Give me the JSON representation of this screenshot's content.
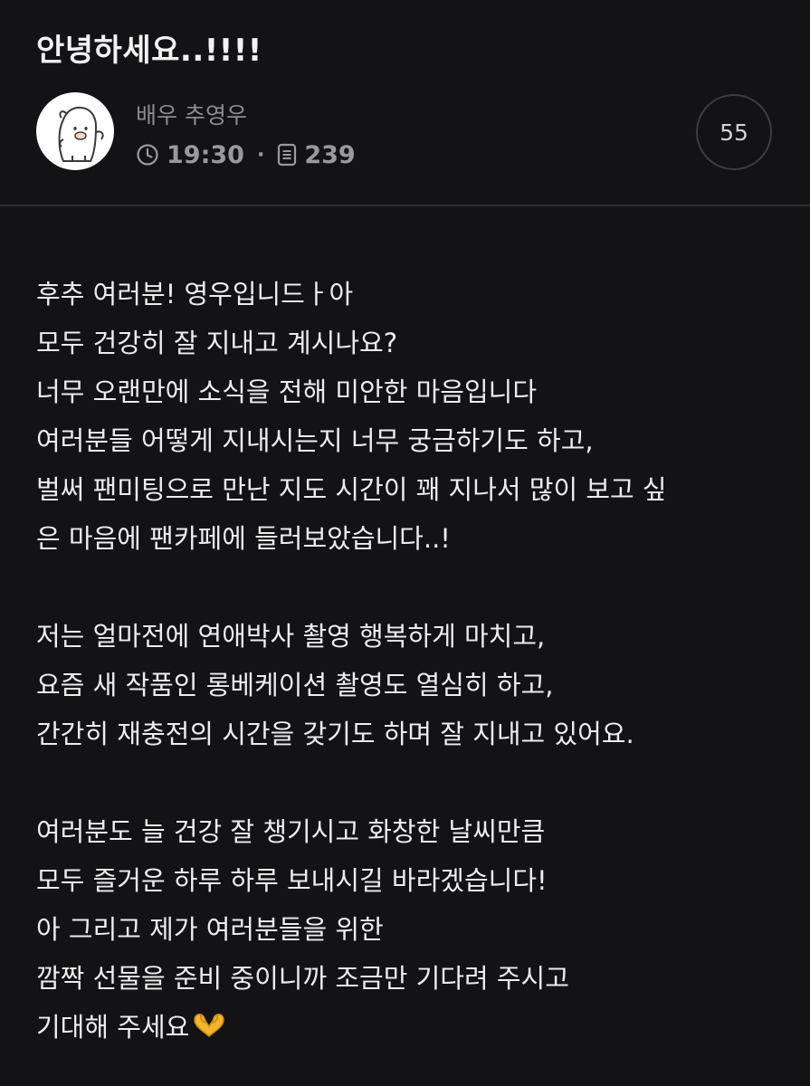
{
  "post": {
    "title": "안녕하세요..!!!!",
    "author": "배우 추영우",
    "time": "19:30",
    "separator": "·",
    "views": "239",
    "comment_count": "55"
  },
  "icons": {
    "avatar": "cartoon-character-avatar",
    "time": "clock-icon",
    "views": "document-icon",
    "emoji": "heart-hands-emoji"
  },
  "colors": {
    "background": "#131316",
    "text": "#ededed",
    "meta": "#9a9a9a",
    "divider": "#2e2e31",
    "emoji": "#f2b52b"
  },
  "body": {
    "paragraph1": [
      "후추 여러분! 영우입니드ㅏ아",
      "모두 건강히 잘 지내고 계시나요?",
      "너무 오랜만에 소식을 전해 미안한 마음입니다",
      "여러분들 어떻게 지내시는지 너무 궁금하기도 하고,",
      "벌써 팬미팅으로 만난 지도 시간이 꽤 지나서 많이 보고 싶",
      "은 마음에 팬카페에 들러보았습니다..!"
    ],
    "paragraph2": [
      "저는 얼마전에 연애박사 촬영 행복하게 마치고,",
      "요즘 새 작품인 롱베케이션 촬영도 열심히 하고,",
      "간간히 재충전의 시간을 갖기도 하며 잘 지내고 있어요."
    ],
    "paragraph3": [
      "여러분도 늘 건강 잘 챙기시고 화창한 날씨만큼",
      "모두 즐거운 하루 하루 보내시길 바라겠습니다!",
      "아 그리고 제가 여러분들을 위한",
      "깜짝 선물을 준비 중이니까 조금만 기다려 주시고",
      "기대해 주세요"
    ]
  }
}
